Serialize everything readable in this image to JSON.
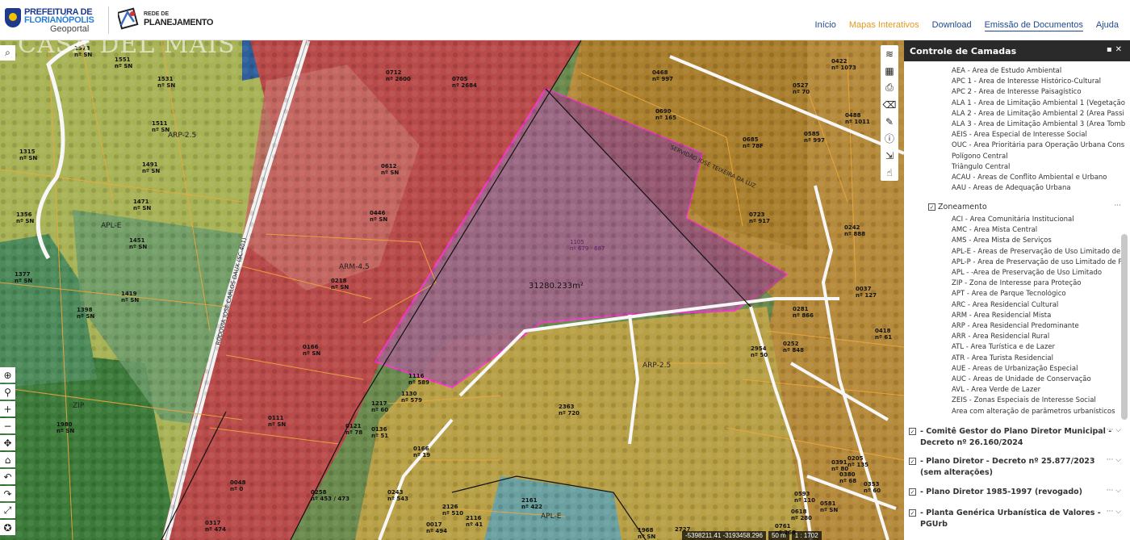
{
  "header": {
    "logo_line1": "PREFEITURA DE",
    "logo_line2": "FLORIANÓPOLIS",
    "logo_sub": "Geoportal",
    "logo2_small": "REDE DE",
    "logo2_main": "PLANEJAMENTO"
  },
  "nav": [
    {
      "label": "Início"
    },
    {
      "label": "Mapas Interativos"
    },
    {
      "label": "Download"
    },
    {
      "label": "Emissão de Documentos"
    },
    {
      "label": "Ajuda"
    }
  ],
  "map": {
    "watermark": "CASA DEL MAIS",
    "area_label": "31280.233m²",
    "lot_label": "1105\nnº 679 · 687",
    "road_label": "RODOVIA JOSÉ CARLOS DAUX (SC-401)",
    "servidao_label": "SERVIDÃO JOSÉ TEIXEIRA DA LUZ",
    "coords": "-5398211.41 -3193458.296",
    "scale": "50 m",
    "ratio": "1 : 1702",
    "zone_labels": [
      "ARP-2.5",
      "APL-E",
      "ZIP",
      "ARM-4.5",
      "ARP-2.5",
      "APL-E"
    ]
  },
  "panel": {
    "title": "Controle de Camadas",
    "legend_top": [
      {
        "label": "AEA - Área de Estudo Ambiental",
        "color": "#2e5bb0",
        "style": "line"
      },
      {
        "label": "APC 1 - Área de Interesse Histórico-Cultural",
        "color": "#e64ad6",
        "style": "box"
      },
      {
        "label": "APC 2 - Área de Interesse Paisagístico",
        "color": "#e64ad6",
        "style": "box"
      },
      {
        "label": "ALA 1 - Área de Limitação Ambiental 1 (Vegetação",
        "color": "#3a8d3a",
        "style": "box"
      },
      {
        "label": "ALA 2 - Área de Limitação Ambiental 2 (Área Passi",
        "color": "#3a8d3a",
        "style": "hatch"
      },
      {
        "label": "ALA 3 - Área de Limitação Ambiental 3 (Área Tomb",
        "color": "#b6d13b",
        "style": "box"
      },
      {
        "label": "AEIS - Área Especial de Interesse Social",
        "color": "#e0a070",
        "style": "dash"
      },
      {
        "label": "OUC - Área Prioritária para Operação Urbana Cons",
        "color": "#4a5cc9",
        "style": "dash"
      },
      {
        "label": "Polígono Central",
        "color": "#222",
        "style": "diag"
      },
      {
        "label": "Triângulo Central",
        "color": "#222",
        "style": "diag"
      },
      {
        "label": "ACAU - Áreas de Conflito Ambiental e Urbano",
        "color": "#e03030",
        "style": "dash"
      },
      {
        "label": "AAU - Áreas de Adequação Urbana",
        "color": "#f09020",
        "style": "box"
      }
    ],
    "zoneamento_title": "Zoneamento",
    "zoneamento": [
      {
        "label": "ACI - Área Comunitária Institucional",
        "color": "#4f7fb0"
      },
      {
        "label": "AMC - Área Mista Central",
        "color": "#d86060"
      },
      {
        "label": "AMS - Área Mista de Serviços",
        "color": "#d08080"
      },
      {
        "label": "APL-E - Áreas de Preservação de Uso Limitado de",
        "color": "#9ad08a"
      },
      {
        "label": "APL-P - Área de Preservação de uso Limitado de P",
        "color": "#ffffff"
      },
      {
        "label": "APL - -Área de Preservação de Uso Limitado",
        "color": "#ffffff"
      },
      {
        "label": "ZIP - Zona de Interesse para Proteção",
        "color": "#5aa05a"
      },
      {
        "label": "APT - Área de Parque Tecnológico",
        "color": "#ffffff"
      },
      {
        "label": "ARC - Área Residencial Cultural",
        "color": "#e8e070"
      },
      {
        "label": "ARM - Área Residencial Mista",
        "color": "#f0b040"
      },
      {
        "label": "ARP - Área Residencial Predominante",
        "color": "#f4e070"
      },
      {
        "label": "ARR - Área Residencial Rural",
        "color": "#ffffff"
      },
      {
        "label": "ATL - Área Turística e de Lazer",
        "color": "#c090b0"
      },
      {
        "label": "ATR - Área Turista Residencial",
        "color": "#d070c0"
      },
      {
        "label": "AUE - Áreas de Urbanização Especial",
        "color": "#5090a0"
      },
      {
        "label": "AUC - Áreas de Unidade de Conservação",
        "color": "#6cc06c"
      },
      {
        "label": "AVL - Área Verde de Lazer",
        "color": "#d0e070"
      },
      {
        "label": "ZEIS - Zonas Especiais de Interesse Social",
        "color": "#c0c0c0"
      },
      {
        "label": "Área com alteração de parâmetros urbanísticos",
        "color": "#e03030"
      }
    ],
    "groups": [
      {
        "label": "- Comitê Gestor do Plano Diretor Municipal - Decreto nº 26.160/2024",
        "ellipsis": "···  ⌵"
      },
      {
        "label": "- Plano Diretor - Decreto nº 25.877/2023 (sem alterações)",
        "ellipsis": "···  ⌵"
      },
      {
        "label": "- Plano Diretor 1985-1997 (revogado)",
        "ellipsis": "···  ⌵"
      },
      {
        "label": "- Planta Genérica Urbanística de Valores - PGUrb",
        "ellipsis": "···  ⌵"
      }
    ]
  }
}
